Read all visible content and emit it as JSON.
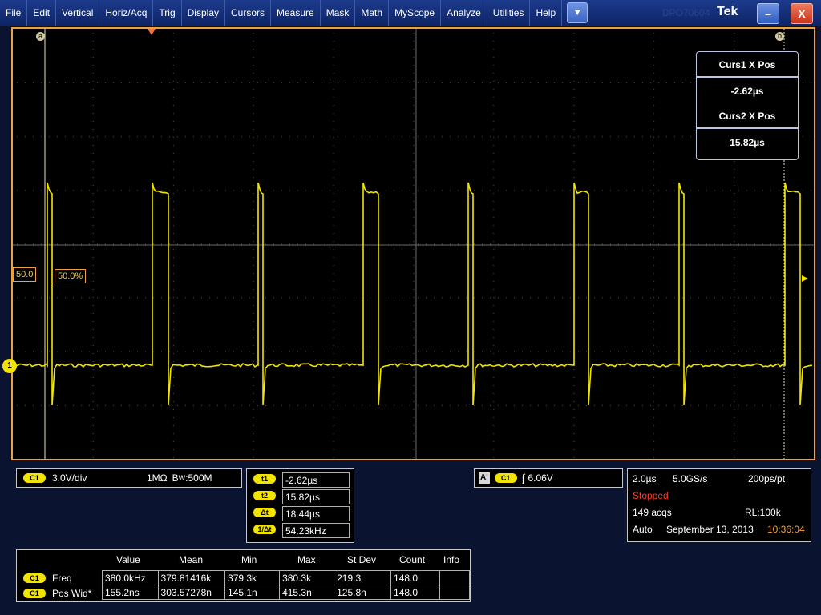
{
  "menu": {
    "items": [
      "File",
      "Edit",
      "Vertical",
      "Horiz/Acq",
      "Trig",
      "Display",
      "Cursors",
      "Measure",
      "Mask",
      "Math",
      "MyScope",
      "Analyze",
      "Utilities",
      "Help"
    ],
    "dropdown_glyph": "▼",
    "model_text": "DPO70604",
    "brand": "Tek",
    "minimize_glyph": "–",
    "close_glyph": "X"
  },
  "graticule": {
    "cursor_a_label": "a",
    "cursor_b_label": "b",
    "level_left": "50.0",
    "level_pct": "50.0%",
    "channel_marker": "1",
    "cursor_readout": {
      "curs1_label": "Curs1 X Pos",
      "curs1_value": "-2.62µs",
      "curs2_label": "Curs2 X Pos",
      "curs2_value": "15.82µs"
    }
  },
  "vertical": {
    "channel": "C1",
    "scale": "3.0V/div",
    "impedance": "1MΩ",
    "bw_prefix": "B",
    "bw_sub": "W",
    "bw_value": ":500M"
  },
  "cursors_panel": [
    {
      "label": "t1",
      "value": "-2.62µs"
    },
    {
      "label": "t2",
      "value": "15.82µs"
    },
    {
      "label": "Δt",
      "value": "18.44µs"
    },
    {
      "label": "1/Δt",
      "value": "54.23kHz"
    }
  ],
  "trigger": {
    "mode_badge": "A'",
    "channel": "C1",
    "slope_glyph": "∫",
    "level": "6.06V"
  },
  "acquisition": {
    "timebase": "2.0µs",
    "sample_rate": "5.0GS/s",
    "resolution": "200ps/pt",
    "state": "Stopped",
    "acqs": "149 acqs",
    "record_length": "RL:100k",
    "trigger_mode": "Auto",
    "date": "September 13, 2013",
    "time": "10:36:04"
  },
  "measurements": {
    "headers": [
      "Value",
      "Mean",
      "Min",
      "Max",
      "St Dev",
      "Count",
      "Info"
    ],
    "rows": [
      {
        "channel": "C1",
        "name": "Freq",
        "cells": [
          "380.0kHz",
          "379.81416k",
          "379.3k",
          "380.3k",
          "219.3",
          "148.0",
          ""
        ]
      },
      {
        "channel": "C1",
        "name": "Pos Wid*",
        "cells": [
          "155.2ns",
          "303.57278n",
          "145.1n",
          "415.3n",
          "125.8n",
          "148.0",
          ""
        ]
      }
    ]
  },
  "colors": {
    "trace": "#f2e300",
    "frame": "#f0a040",
    "stopped": "#ff3b1f",
    "time": "#f0a040"
  }
}
